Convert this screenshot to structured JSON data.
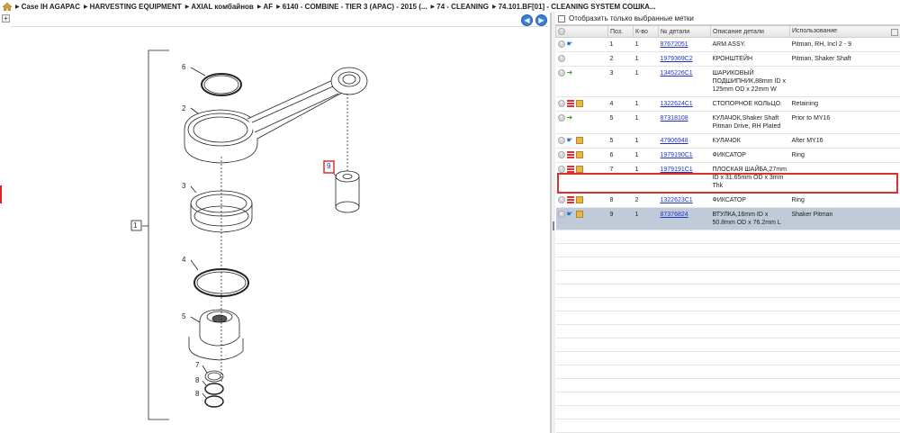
{
  "breadcrumb": [
    "Case IH AGAPAC",
    "HARVESTING EQUIPMENT",
    "AXIAL комбайнов",
    "AF",
    "6140 - COMBINE - TIER 3 (APAC) - 2015 (...",
    "74 - CLEANING",
    "74.101.BF[01] - CLEANING SYSTEM СОШКА..."
  ],
  "drawing": {
    "group_callout": "1",
    "callouts": [
      "6",
      "2",
      "3",
      "4",
      "5",
      "7",
      "8",
      "8",
      "9"
    ]
  },
  "filter": {
    "label": "Отобразить только выбранные метки"
  },
  "table": {
    "headers": [
      "Поз.",
      "К-во",
      "№ детали",
      "Описание детали",
      "Использование"
    ],
    "rows": [
      {
        "pos": "1",
        "qty": "1",
        "part": "87672051",
        "desc": "ARM ASSY.",
        "usage": "Pitman, RH, Incl 2 - 9",
        "icons": [
          "add",
          "hand"
        ]
      },
      {
        "pos": "2",
        "qty": "1",
        "part": "1979369C2",
        "desc": "КРОНШТЕЙН",
        "usage": "Pitman, Shaker Shaft",
        "icons": [
          "add"
        ]
      },
      {
        "pos": "3",
        "qty": "1",
        "part": "1345226C1",
        "desc": "ШАРИКОВЫЙ ПОДШИПНИК,88mm ID x 125mm OD x 22mm W",
        "usage": "",
        "icons": [
          "add",
          "arrow"
        ]
      },
      {
        "pos": "4",
        "qty": "1",
        "part": "1322624C1",
        "desc": "СТОПОРНОЕ КОЛЬЦО.",
        "usage": "Retaining",
        "icons": [
          "add",
          "list",
          "box"
        ]
      },
      {
        "pos": "5",
        "qty": "1",
        "part": "87318108",
        "desc": "КУЛАЧОК,Shaker Shaft Pitman Drive, RH Plated",
        "usage": "Prior to MY16",
        "icons": [
          "add",
          "arrow"
        ]
      },
      {
        "pos": "5",
        "qty": "1",
        "part": "47906948",
        "desc": "КУЛАЧОК",
        "usage": "After MY16",
        "icons": [
          "add",
          "hand",
          "box"
        ]
      },
      {
        "pos": "6",
        "qty": "1",
        "part": "1979190C1",
        "desc": "ФИКСАТОР",
        "usage": "Ring",
        "icons": [
          "add",
          "list",
          "box"
        ]
      },
      {
        "pos": "7",
        "qty": "1",
        "part": "1979191C1",
        "desc": "ПЛОСКАЯ ШАЙБА,27mm ID x 31.65mm OD x 3mm Thk",
        "usage": "",
        "icons": [
          "add",
          "list",
          "box"
        ]
      },
      {
        "pos": "8",
        "qty": "2",
        "part": "1322623C1",
        "desc": "ФИКСАТОР",
        "usage": "Ring",
        "icons": [
          "add",
          "list",
          "box"
        ]
      },
      {
        "pos": "9",
        "qty": "1",
        "part": "87376824",
        "desc": "ВТУЛКА,16mm ID x 50.8mm OD x 76.2mm L",
        "usage": "Shaker Pitman",
        "icons": [
          "add",
          "hand",
          "box"
        ],
        "selected": true
      }
    ]
  }
}
